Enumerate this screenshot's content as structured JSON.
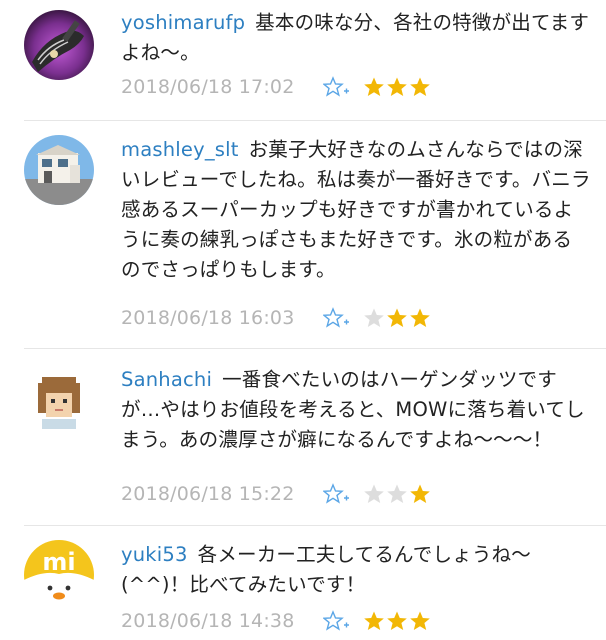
{
  "colors": {
    "username": "#2d7fc1",
    "text": "#222222",
    "timestamp": "#b5b5b5",
    "star_filled": "#f2b705",
    "star_empty": "#dddddd",
    "fav_icon": "#5ba6e6"
  },
  "comments": [
    {
      "username": "yoshimarufp",
      "text": "基本の味な分、各社の特徴が出てますよね～。",
      "timestamp": "2018/06/18 17:02",
      "rating": 3,
      "avatar_icon": "guitar-photo-icon"
    },
    {
      "username": "mashley_slt",
      "text": "お菓子大好きなのムさんならではの深いレビューでしたね。私は奏が一番好きです。バニラ感あるスーパーカップも好きですが書かれているように奏の練乳っぽさもまた好きです。氷の粒があるのでさっぱりもします。",
      "timestamp": "2018/06/18 16:03",
      "rating": 2,
      "avatar_icon": "house-photo-icon"
    },
    {
      "username": "Sanhachi",
      "text": "一番食べたいのはハーゲンダッツですが…やはりお値段を考えると、MOWに落ち着いてしまう。あの濃厚さが癖になるんですよね～～～！",
      "timestamp": "2018/06/18 15:22",
      "rating": 1,
      "avatar_icon": "pixel-face-icon"
    },
    {
      "username": "yuki53",
      "text": "各メーカー工夫してるんでしょうね～(^^)！比べてみたいです！",
      "timestamp": "2018/06/18 14:38",
      "rating": 3,
      "avatar_icon": "mi-logo-icon"
    }
  ],
  "avatar_logo_text": "mi"
}
